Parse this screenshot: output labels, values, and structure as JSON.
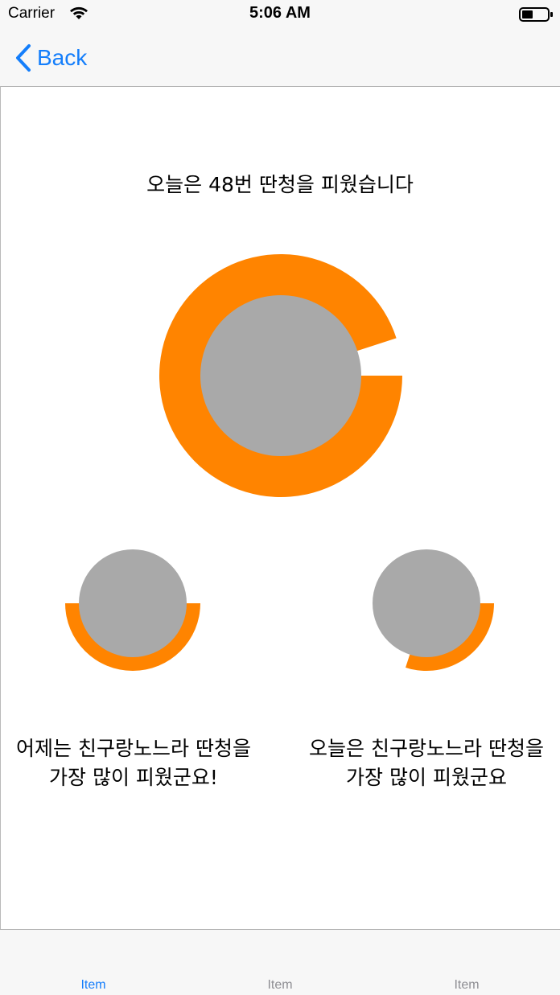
{
  "status_bar": {
    "carrier": "Carrier",
    "time": "5:06 AM",
    "wifi_icon": "wifi-icon",
    "battery_icon": "battery-icon"
  },
  "nav_bar": {
    "back_label": "Back",
    "back_icon": "chevron-left-icon"
  },
  "main": {
    "headline": "오늘은 48번 딴청을 피웠습니다",
    "captions": {
      "left": "어제는 친구랑노느라 딴청을 가장 많이 피웠군요!",
      "right": "오늘은 친구랑노느라 딴청을 가장 많이 피웠군요"
    }
  },
  "chart_data": [
    {
      "type": "pie",
      "role": "today-total",
      "progress_fraction": 0.95,
      "accent_color": "#ff8400",
      "center_color": "#a9a9a9"
    },
    {
      "type": "pie",
      "role": "yesterday-top",
      "progress_fraction": 0.5,
      "accent_color": "#ff8400",
      "center_color": "#a9a9a9"
    },
    {
      "type": "pie",
      "role": "today-top",
      "progress_fraction": 0.3,
      "accent_color": "#ff8400",
      "center_color": "#a9a9a9"
    }
  ],
  "tab_bar": {
    "items": [
      {
        "label": "Item",
        "selected": true
      },
      {
        "label": "Item",
        "selected": false
      },
      {
        "label": "Item",
        "selected": false
      }
    ],
    "selected_color": "#147efb",
    "unselected_color": "#8e8e93"
  }
}
